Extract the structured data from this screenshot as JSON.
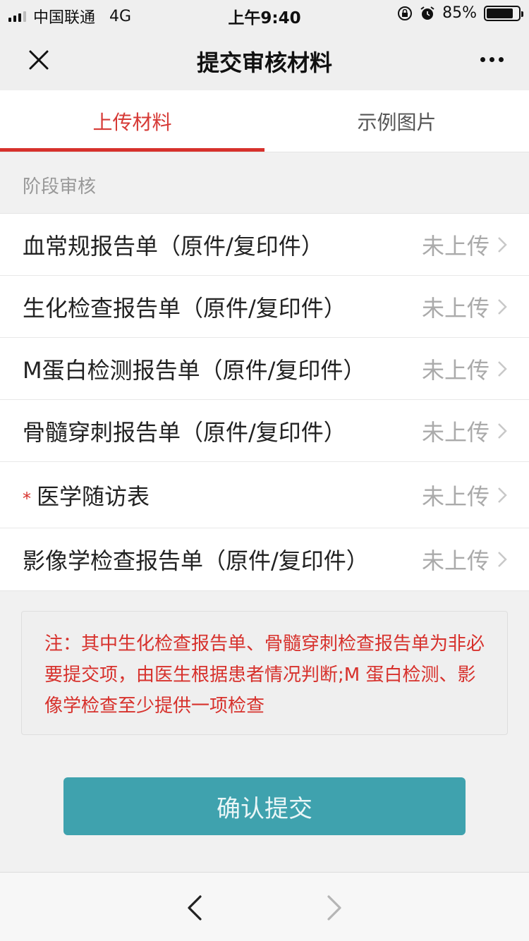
{
  "status_bar": {
    "carrier": "中国联通",
    "network": "4G",
    "time": "上午9:40",
    "battery": "85%",
    "battery_level": 0.85,
    "icons": [
      "signal-icon",
      "orientation-lock-icon",
      "alarm-icon",
      "battery-icon"
    ]
  },
  "nav": {
    "title": "提交审核材料",
    "left_icon": "close-icon",
    "right_icon": "more-icon"
  },
  "tabs": [
    {
      "label": "上传材料",
      "active": true
    },
    {
      "label": "示例图片",
      "active": false
    }
  ],
  "section": {
    "title": "阶段审核"
  },
  "items": [
    {
      "label": "血常规报告单（原件/复印件）",
      "required": false,
      "status": "未上传"
    },
    {
      "label": "生化检查报告单（原件/复印件）",
      "required": false,
      "status": "未上传"
    },
    {
      "label": "M蛋白检测报告单（原件/复印件）",
      "required": false,
      "status": "未上传"
    },
    {
      "label": "骨髓穿刺报告单（原件/复印件）",
      "required": false,
      "status": "未上传"
    },
    {
      "label": "医学随访表",
      "required": true,
      "required_mark": "*",
      "status": "未上传"
    },
    {
      "label": "影像学检查报告单（原件/复印件）",
      "required": false,
      "status": "未上传"
    }
  ],
  "note": {
    "text": "注：其中生化检查报告单、骨髓穿刺检查报告单为非必要提交项，由医生根据患者情况判断;M 蛋白检测、影像学检查至少提供一项检查"
  },
  "confirm_button": {
    "label": "确认提交"
  },
  "colors": {
    "accent_red": "#d7312c",
    "button_teal": "#3fa2ae"
  }
}
